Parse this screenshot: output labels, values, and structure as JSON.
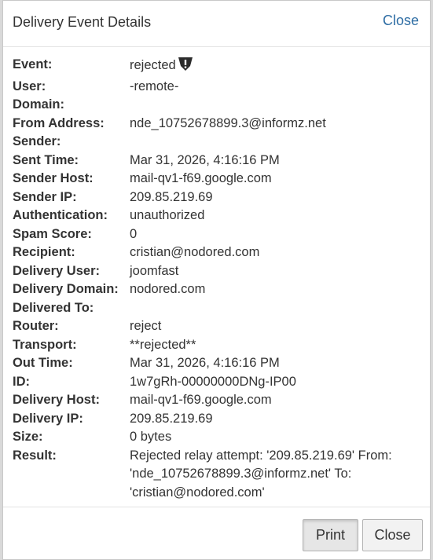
{
  "dialog": {
    "title": "Delivery Event Details",
    "close_link": "Close"
  },
  "details": [
    {
      "label": "Event:",
      "value": "rejected",
      "icon": "warning-shield-icon"
    },
    {
      "label": "User:",
      "value": "-remote-"
    },
    {
      "label": "Domain:",
      "value": ""
    },
    {
      "label": "From Address:",
      "value": "nde_10752678899.3@informz.net"
    },
    {
      "label": "Sender:",
      "value": ""
    },
    {
      "label": "Sent Time:",
      "value": "Mar 31, 2026, 4:16:16 PM"
    },
    {
      "label": "Sender Host:",
      "value": "mail-qv1-f69.google.com"
    },
    {
      "label": "Sender IP:",
      "value": "209.85.219.69"
    },
    {
      "label": "Authentication:",
      "value": "unauthorized"
    },
    {
      "label": "Spam Score:",
      "value": "0"
    },
    {
      "label": "Recipient:",
      "value": "cristian@nodored.com"
    },
    {
      "label": "Delivery User:",
      "value": "joomfast"
    },
    {
      "label": "Delivery Domain:",
      "value": "nodored.com"
    },
    {
      "label": "Delivered To:",
      "value": ""
    },
    {
      "label": "Router:",
      "value": "reject"
    },
    {
      "label": "Transport:",
      "value": "**rejected**"
    },
    {
      "label": "Out Time:",
      "value": "Mar 31, 2026, 4:16:16 PM"
    },
    {
      "label": "ID:",
      "value": "1w7gRh-00000000DNg-IP00"
    },
    {
      "label": "Delivery Host:",
      "value": "mail-qv1-f69.google.com"
    },
    {
      "label": "Delivery IP:",
      "value": "209.85.219.69"
    },
    {
      "label": "Size:",
      "value": "0 bytes"
    },
    {
      "label": "Result:",
      "value": "Rejected relay attempt: '209.85.219.69' From: 'nde_10752678899.3@informz.net' To: 'cristian@nodored.com'"
    }
  ],
  "footer": {
    "print_label": "Print",
    "close_label": "Close"
  }
}
